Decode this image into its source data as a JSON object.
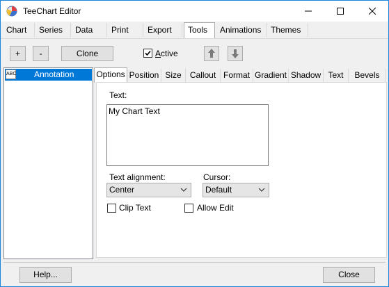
{
  "window": {
    "title": "TeeChart Editor",
    "minimize_icon": "minimize-icon",
    "maximize_icon": "maximize-icon",
    "close_icon": "close-icon"
  },
  "main_tabs": [
    "Chart",
    "Series",
    "Data",
    "Print",
    "Export",
    "Tools",
    "Animations",
    "Themes"
  ],
  "main_tab_active": "Tools",
  "toolbar": {
    "add_label": "+",
    "remove_label": "-",
    "clone_label": "Clone",
    "active_label": "Active",
    "active_checked": true,
    "move_up_icon": "arrow-up-icon",
    "move_down_icon": "arrow-down-icon"
  },
  "tools_list": {
    "items": [
      {
        "label": "Annotation",
        "icon": "annotation-icon",
        "icon_text": "ABC",
        "selected": true
      }
    ]
  },
  "sub_tabs": [
    "Options",
    "Position",
    "Size",
    "Callout",
    "Format",
    "Gradient",
    "Shadow",
    "Text",
    "Bevels"
  ],
  "sub_tab_active": "Options",
  "options": {
    "text_label": "Text:",
    "text_value": "My Chart Text",
    "text_alignment_label": "Text alignment:",
    "text_alignment_value": "Center",
    "cursor_label": "Cursor:",
    "cursor_value": "Default",
    "clip_text_label": "Clip Text",
    "clip_text_checked": false,
    "allow_edit_label": "Allow Edit",
    "allow_edit_checked": false
  },
  "footer": {
    "help_label": "Help...",
    "close_label": "Close"
  },
  "colors": {
    "selection": "#0078d7",
    "window_border": "#1883d7",
    "arrow_button": "#7a7a7a"
  }
}
